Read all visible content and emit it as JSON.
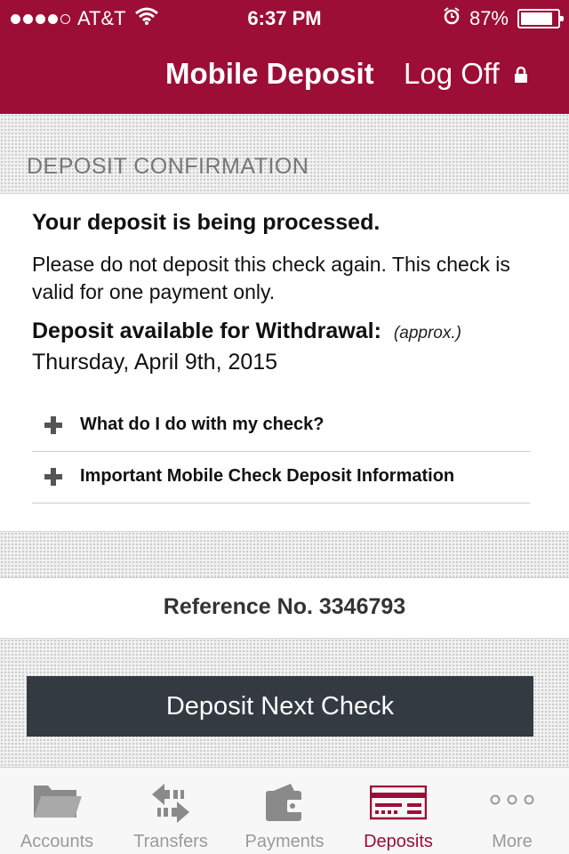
{
  "status_bar": {
    "carrier": "AT&T",
    "time": "6:37 PM",
    "battery_percent_text": "87%",
    "battery_level": 0.87
  },
  "nav": {
    "title": "Mobile Deposit",
    "logoff_label": "Log Off"
  },
  "section": {
    "heading": "DEPOSIT CONFIRMATION"
  },
  "confirmation": {
    "headline": "Your deposit is being processed.",
    "message": "Please do not deposit this check again. This check is valid for one payment only.",
    "availability_label": "Deposit available for Withdrawal:",
    "availability_note": "(approx.)",
    "availability_date": "Thursday, April 9th, 2015"
  },
  "expanders": [
    {
      "label": "What do I do with my check?"
    },
    {
      "label": "Important Mobile Check Deposit Information"
    }
  ],
  "reference": "Reference No. 3346793",
  "primary_button": "Deposit Next Check",
  "tab_bar": {
    "items": [
      {
        "label": "Accounts",
        "icon": "folder-icon"
      },
      {
        "label": "Transfers",
        "icon": "transfer-arrows-icon"
      },
      {
        "label": "Payments",
        "icon": "wallet-icon"
      },
      {
        "label": "Deposits",
        "icon": "check-icon",
        "active": true
      },
      {
        "label": "More",
        "icon": "more-dots-icon"
      }
    ]
  },
  "colors": {
    "brand": "#9c0e36",
    "button": "#333a42",
    "inactive_tab": "#9a9a9a"
  }
}
